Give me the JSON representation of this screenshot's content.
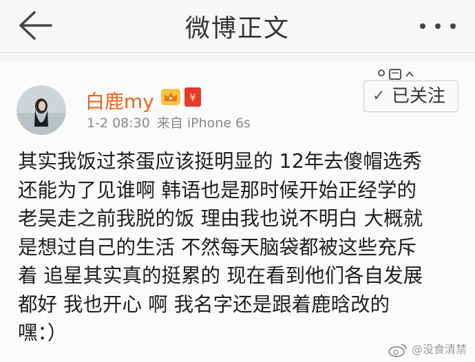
{
  "header": {
    "title": "微博正文"
  },
  "icons": {
    "back": "arrow-left-icon",
    "more": "more-dots-icon",
    "crown": "crown-icon",
    "red_packet": "red-packet-icon",
    "check": "check-icon",
    "weibo": "weibo-logo-icon"
  },
  "post": {
    "username": "白鹿my",
    "time": "1-2 08:30",
    "source": "来自 iPhone 6s",
    "follow_label": "已关注",
    "red_packet_glyph": "¥",
    "check_glyph": "✓",
    "lines": [
      "其实我饭过茶蛋应该挺明显的 12年去傻帽选秀",
      "还能为了见谁啊 韩语也是那时候开始正经学的",
      "老吴走之前我脱的饭 理由我也说不明白 大概就",
      "是想过自己的生活 不然每天脑袋都被这些充斥",
      "着 追星其实真的挺累的 现在看到他们各自发展",
      "都好 我也开心 啊 我名字还是跟着鹿晗改的",
      "嘿：）"
    ]
  },
  "watermark": {
    "text": "@没食清禁"
  },
  "colors": {
    "username": "#e8651a",
    "red_packet": "#e43a2c",
    "crown": "#f2a81d",
    "meta": "#888888"
  }
}
